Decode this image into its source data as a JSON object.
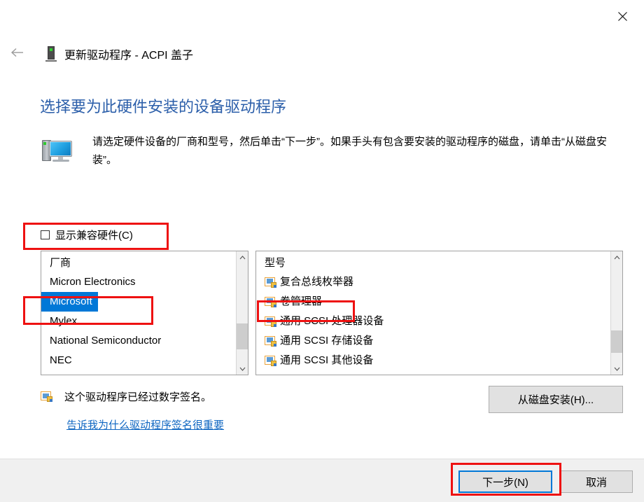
{
  "window": {
    "close_icon": "close-icon",
    "back_icon": "back-arrow-icon",
    "device_icon": "device-icon",
    "wizard_title": "更新驱动程序 - ACPI 盖子"
  },
  "page": {
    "heading": "选择要为此硬件安装的设备驱动程序",
    "description": "请选定硬件设备的厂商和型号，然后单击“下一步”。如果手头有包含要安装的驱动程序的磁盘，请单击“从磁盘安装”。",
    "computer_icon": "computer-icon"
  },
  "compat_checkbox": {
    "label": "显示兼容硬件(C)",
    "checked": false
  },
  "manufacturer_list": {
    "header": "厂商",
    "items": [
      {
        "label": "Micron Electronics",
        "selected": false
      },
      {
        "label": "Microsoft",
        "selected": true
      },
      {
        "label": "Mylex",
        "selected": false
      },
      {
        "label": "National Semiconductor",
        "selected": false
      },
      {
        "label": "NEC",
        "selected": false
      }
    ],
    "scrollbar": {
      "up_arrow": "chevron-up-icon",
      "down_arrow": "chevron-down-icon"
    }
  },
  "model_list": {
    "header": "型号",
    "items": [
      {
        "label": "复合总线枚举器",
        "icon": "driver-icon",
        "selected": false
      },
      {
        "label": "卷管理器",
        "icon": "driver-icon",
        "selected": false
      },
      {
        "label": "通用 SCSI 处理器设备",
        "icon": "driver-icon",
        "selected": false
      },
      {
        "label": "通用 SCSI 存储设备",
        "icon": "driver-icon",
        "selected": false
      },
      {
        "label": "通用 SCSI 其他设备",
        "icon": "driver-icon",
        "selected": false
      }
    ],
    "scrollbar": {
      "up_arrow": "chevron-up-icon",
      "down_arrow": "chevron-down-icon"
    }
  },
  "signature": {
    "icon": "driver-signed-icon",
    "text": "这个驱动程序已经过数字签名。",
    "link": "告诉我为什么驱动程序签名很重要"
  },
  "buttons": {
    "have_disk": "从磁盘安装(H)...",
    "next": "下一步(N)",
    "cancel": "取消"
  },
  "colors": {
    "heading_blue": "#2c5faa",
    "selection_blue": "#0078d7",
    "link_blue": "#1067c2",
    "annotation_red": "#ee1111",
    "footer_gray": "#f0f0f0"
  }
}
